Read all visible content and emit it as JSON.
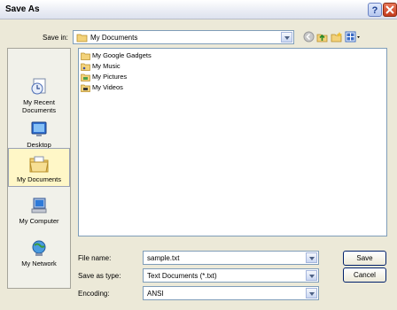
{
  "window": {
    "title": "Save As",
    "help_label": "?"
  },
  "save_in": {
    "label": "Save in:",
    "value": "My Documents"
  },
  "places": [
    {
      "label": "My Recent Documents",
      "icon": "recent-documents-icon"
    },
    {
      "label": "Desktop",
      "icon": "desktop-icon"
    },
    {
      "label": "My Documents",
      "icon": "my-documents-icon",
      "selected": true
    },
    {
      "label": "My Computer",
      "icon": "my-computer-icon"
    },
    {
      "label": "My Network",
      "icon": "my-network-icon"
    }
  ],
  "files": [
    {
      "name": "My Google Gadgets"
    },
    {
      "name": "My Music"
    },
    {
      "name": "My Pictures"
    },
    {
      "name": "My Videos"
    }
  ],
  "form": {
    "file_name_label": "File name:",
    "file_name_value": "sample.txt",
    "save_type_label": "Save as type:",
    "save_type_value": "Text Documents (*.txt)",
    "encoding_label": "Encoding:",
    "encoding_value": "ANSI"
  },
  "buttons": {
    "save": "Save",
    "cancel": "Cancel"
  },
  "colors": {
    "accent": "#00206b",
    "selected_place": "#fff7c7",
    "dialog_bg": "#ECE9D8"
  }
}
